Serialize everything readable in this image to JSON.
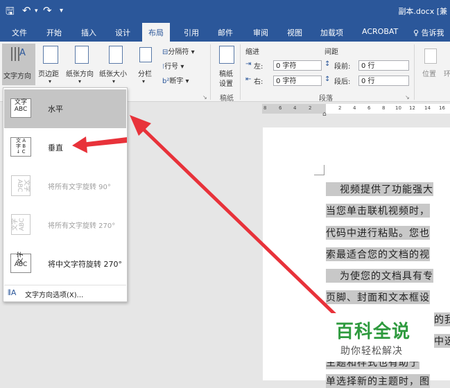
{
  "quick_access": {
    "save_icon": "save-icon",
    "undo_icon": "undo-icon",
    "redo_icon": "redo-icon",
    "customize_icon": "customize-icon"
  },
  "title": {
    "filename": "副本.docx [兼"
  },
  "tabs": [
    "文件",
    "开始",
    "插入",
    "设计",
    "布局",
    "引用",
    "邮件",
    "审阅",
    "视图",
    "加载项",
    "ACROBAT",
    "♀ 告诉我"
  ],
  "active_tab": "布局",
  "ribbon": {
    "text_direction": "文字方向",
    "margins": "页边距",
    "orientation": "纸张方向",
    "size": "纸张大小",
    "columns": "分栏",
    "breaks": "分隔符 ▾",
    "line_numbers": "行号 ▾",
    "hyphenation": "断字 ▾",
    "draft_paper": "稿纸\n设置",
    "draft_paper_l1": "稿纸",
    "draft_paper_l2": "设置",
    "draft_group": "稿纸",
    "indent_header": "缩进",
    "indent_left_label": "左:",
    "indent_left_value": "0 字符",
    "indent_right_label": "右:",
    "indent_right_value": "0 字符",
    "spacing_header": "间距",
    "spacing_before_label": "段前:",
    "spacing_before_value": "0 行",
    "spacing_after_label": "段后:",
    "spacing_after_value": "0 行",
    "paragraph_group": "段落",
    "position": "位置",
    "wrap": "环"
  },
  "ruler": {
    "ticks": [
      "8",
      "6",
      "4",
      "2",
      "2",
      "4",
      "6",
      "8",
      "10",
      "12",
      "14",
      "16"
    ]
  },
  "menu": {
    "items": [
      {
        "icon_text": "文字\nABC",
        "label": "水平",
        "state": "selected"
      },
      {
        "icon_text": "↓",
        "label": "垂直",
        "state": "enabled"
      },
      {
        "icon_text": "",
        "label": "将所有文字旋转 90°",
        "state": "disabled"
      },
      {
        "icon_text": "",
        "label": "将所有文字旋转 270°",
        "state": "disabled"
      },
      {
        "icon_text": "",
        "label": "将中文字符旋转 270°",
        "state": "enabled"
      }
    ],
    "options_label": "文字方向选项(X)..."
  },
  "document": {
    "lines": [
      "视频提供了功能强大",
      "当您单击联机视频时，",
      "代码中进行粘贴。您也",
      "索最适合您的文档的视",
      "为使您的文档具有专",
      "页脚、封面和文本框设",
      "的我",
      "中选",
      "主题和样式也有助于",
      "单选择新的主题时，图"
    ]
  },
  "watermark": {
    "title": "百科全说",
    "subtitle": "助你轻松解决"
  },
  "colors": {
    "brand": "#2b579a",
    "arrow": "#e8323a",
    "watermark_green": "#2e9a3e"
  }
}
